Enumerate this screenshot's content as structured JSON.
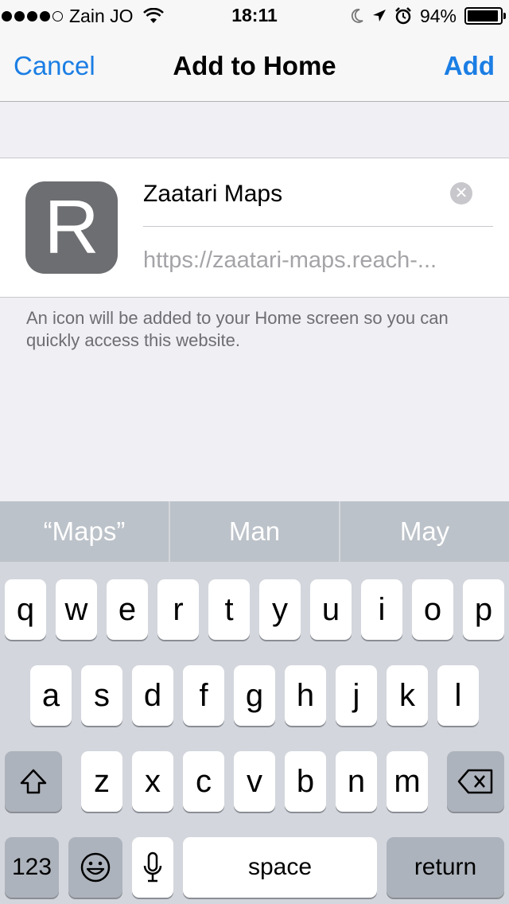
{
  "status_bar": {
    "carrier": "Zain JO",
    "time": "18:11",
    "battery_percent": "94%",
    "battery_level": 0.94
  },
  "nav": {
    "cancel_label": "Cancel",
    "title": "Add to Home",
    "add_label": "Add"
  },
  "bookmark": {
    "icon_letter": "R",
    "name_value": "Zaatari Maps",
    "url": "https://zaatari-maps.reach-..."
  },
  "hint_text": "An icon will be added to your Home screen so you can quickly access this website.",
  "keyboard": {
    "suggestions": [
      "“Maps”",
      "Man",
      "May"
    ],
    "row1": [
      "q",
      "w",
      "e",
      "r",
      "t",
      "y",
      "u",
      "i",
      "o",
      "p"
    ],
    "row2": [
      "a",
      "s",
      "d",
      "f",
      "g",
      "h",
      "j",
      "k",
      "l"
    ],
    "row3": [
      "z",
      "x",
      "c",
      "v",
      "b",
      "n",
      "m"
    ],
    "numbers_label": "123",
    "space_label": "space",
    "return_label": "return"
  }
}
